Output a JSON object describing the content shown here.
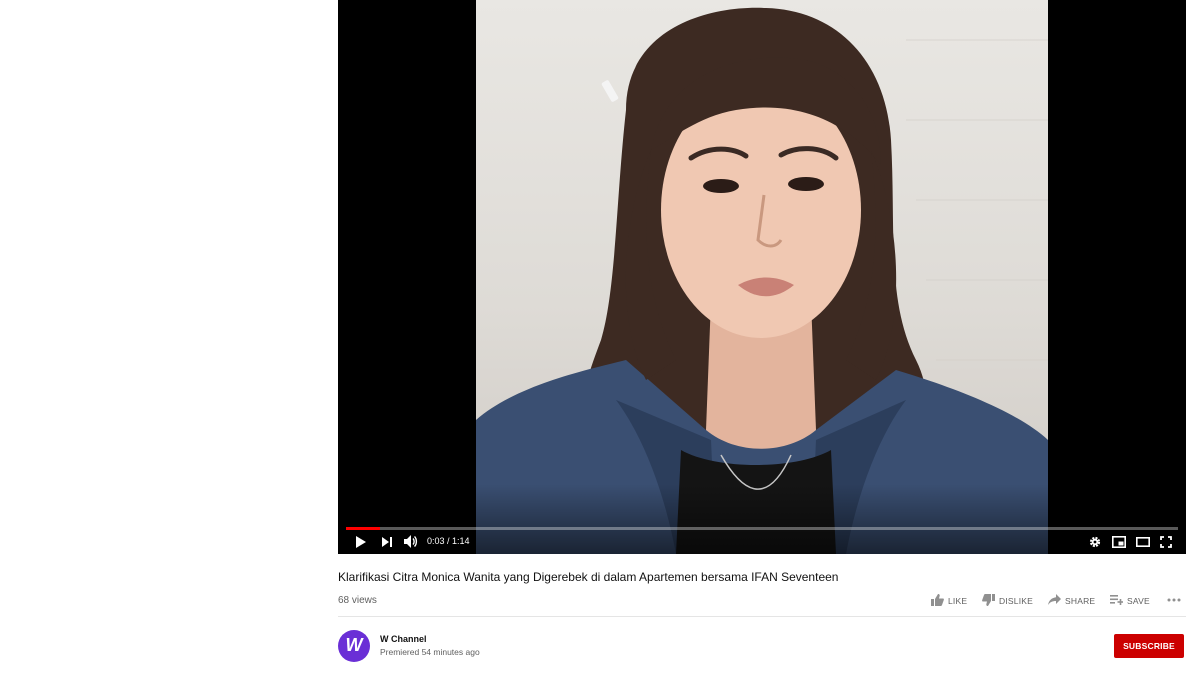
{
  "player": {
    "time_current": "0:03",
    "time_separator": " / ",
    "time_total": "1:14",
    "progress_played_fraction": 0.041,
    "progress_loaded_fraction": 0.041,
    "colors": {
      "played": "#ff0000",
      "background": "#000000"
    }
  },
  "video": {
    "title": "Klarifikasi Citra Monica Wanita yang Digerebek di dalam Apartemen bersama IFAN Seventeen",
    "views": "68 views"
  },
  "actions": {
    "like": "LIKE",
    "dislike": "DISLIKE",
    "share": "SHARE",
    "save": "SAVE"
  },
  "channel": {
    "name": "W Channel",
    "premiered": "Premiered 54 minutes ago",
    "avatar_letter": "W",
    "avatar_color": "#6a2fd6"
  },
  "subscribe": {
    "label": "SUBSCRIBE",
    "color": "#cc0000"
  },
  "icons": {
    "play": "play-icon",
    "next": "next-icon",
    "volume": "volume-icon",
    "settings": "gear-icon",
    "miniplayer": "miniplayer-icon",
    "theater": "theater-mode-icon",
    "fullscreen": "fullscreen-icon",
    "like": "thumbs-up-icon",
    "dislike": "thumbs-down-icon",
    "share": "share-arrow-icon",
    "save": "playlist-add-icon",
    "more": "more-horizontal-icon"
  }
}
